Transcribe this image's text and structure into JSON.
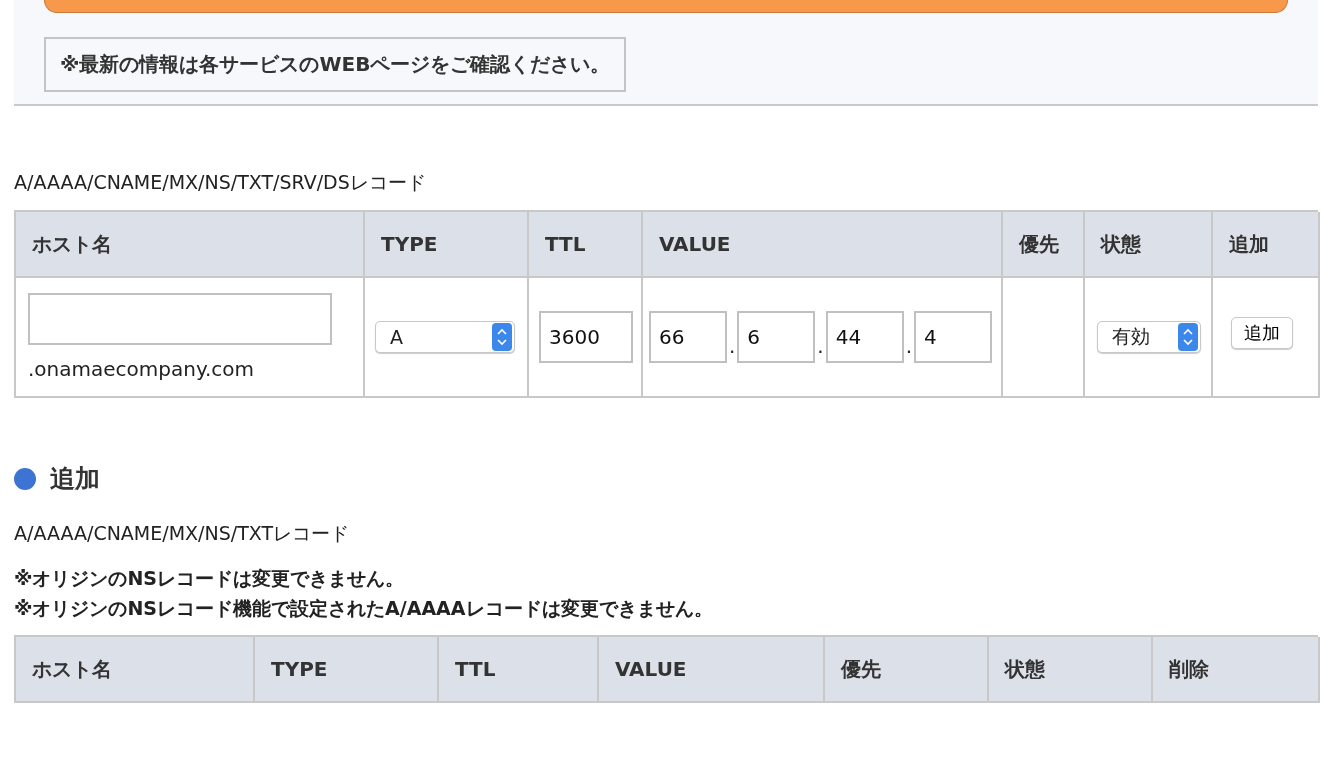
{
  "notice": "※最新の情報は各サービスのWEBページをご確認ください。",
  "records_form": {
    "title": "A/AAAA/CNAME/MX/NS/TXT/SRV/DSレコード",
    "columns": [
      "ホスト名",
      "TYPE",
      "TTL",
      "VALUE",
      "優先",
      "状態",
      "追加"
    ],
    "host_suffix": ".onamaecompany.com",
    "type": "A",
    "ttl": "3600",
    "value_octets": [
      "66",
      "6",
      "44",
      "4"
    ],
    "separator": ".",
    "status": "有効",
    "add_button": "追加"
  },
  "added": {
    "heading": "追加",
    "subtitle": "A/AAAA/CNAME/MX/NS/TXTレコード",
    "notes": [
      "※オリジンのNSレコードは変更できません。",
      "※オリジンのNSレコード機能で設定されたA/AAAAレコードは変更できません。"
    ],
    "columns": [
      "ホスト名",
      "TYPE",
      "TTL",
      "VALUE",
      "優先",
      "状態",
      "削除"
    ]
  }
}
